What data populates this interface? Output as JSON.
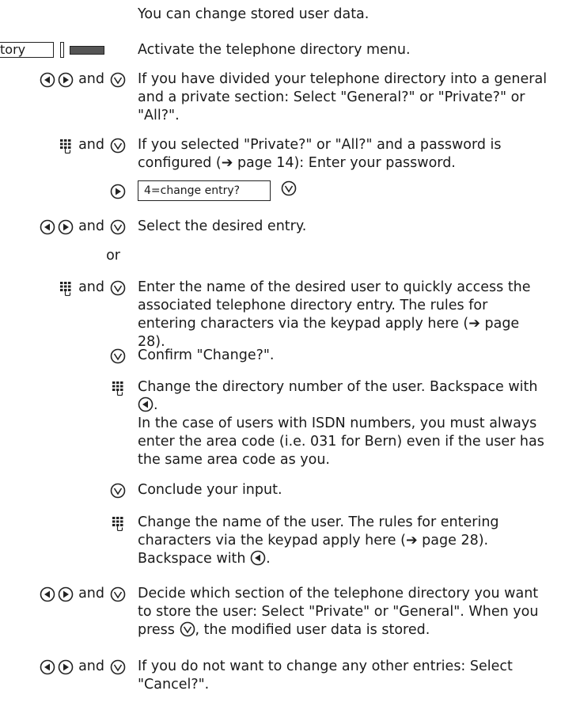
{
  "intro": "You can change stored user data.",
  "directory_key": "tory",
  "connector": "and",
  "option_or": "or",
  "display_text": "4=change entry?",
  "steps": [
    {
      "text": "Activate the telephone directory menu."
    },
    {
      "text": "If you have divided your telephone directory into a general and a private section: Select \"General?\" or \"Private?\" or \"All?\"."
    },
    {
      "text": "If you selected \"Private?\" or \"All?\" and a password is configured (➔ page 14): Enter your password."
    },
    {
      "text": "Select the desired entry."
    },
    {
      "text": "Enter the name of the desired user to quickly access the associated telephone directory entry. The rules for entering characters via the keypad apply here (➔ page 28)."
    },
    {
      "text": "Confirm \"Change?\"."
    },
    {
      "text_a": "Change the directory number of the user. Backspace with",
      "text_b": ".",
      "text_c": "In the case of users with ISDN numbers, you must always enter the area code (i.e. 031 for Bern) even if the user has the same area code as you."
    },
    {
      "text": "Conclude your input."
    },
    {
      "text_a": "Change the name of the user. The rules for entering characters via the keypad apply here (➔ page 28). Backspace with",
      "text_b": "."
    },
    {
      "text_a": "Decide which section of the telephone directory you want to store the user: Select \"Private\" or \"General\". When you press",
      "text_b": ", the modified user data is stored."
    },
    {
      "text": "If you do not want to change any other entries: Select \"Cancel?\"."
    }
  ]
}
